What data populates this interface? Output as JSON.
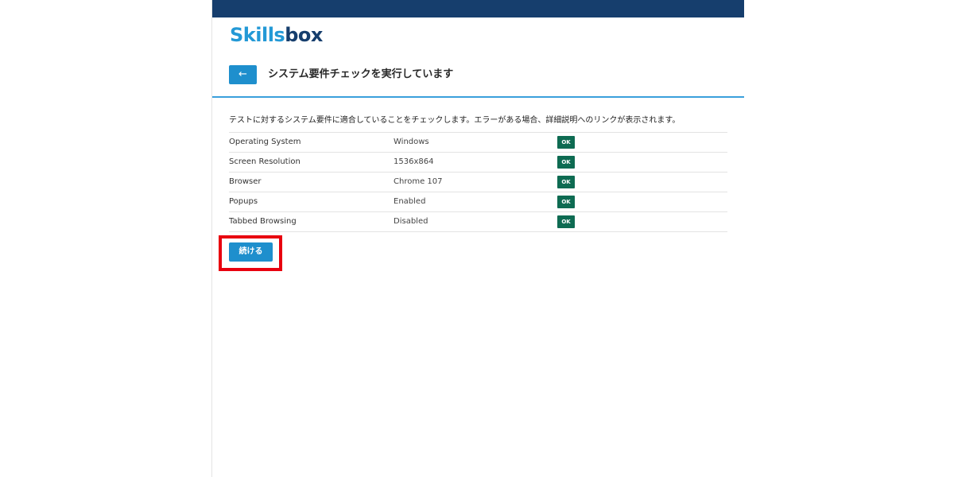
{
  "brand": {
    "logo_part1": "Skills",
    "logo_part2": "box",
    "colors": {
      "navbar": "#163e6d",
      "logo_light": "#2399d6",
      "logo_dark": "#163e6d",
      "button": "#1e8fcd",
      "ok_badge": "#0e6b52",
      "highlight": "#e8000f"
    }
  },
  "header": {
    "back_icon": "arrow-left-icon",
    "back_glyph": "←",
    "title": "システム要件チェックを実行しています"
  },
  "main": {
    "description": "テストに対するシステム要件に適合していることをチェックします。エラーがある場合、詳細説明へのリンクが表示されます。",
    "requirements": [
      {
        "label": "Operating System",
        "value": "Windows",
        "status": "OK"
      },
      {
        "label": "Screen Resolution",
        "value": "1536x864",
        "status": "OK"
      },
      {
        "label": "Browser",
        "value": "Chrome 107",
        "status": "OK"
      },
      {
        "label": "Popups",
        "value": "Enabled",
        "status": "OK"
      },
      {
        "label": "Tabbed Browsing",
        "value": "Disabled",
        "status": "OK"
      }
    ],
    "continue_label": "続ける"
  }
}
